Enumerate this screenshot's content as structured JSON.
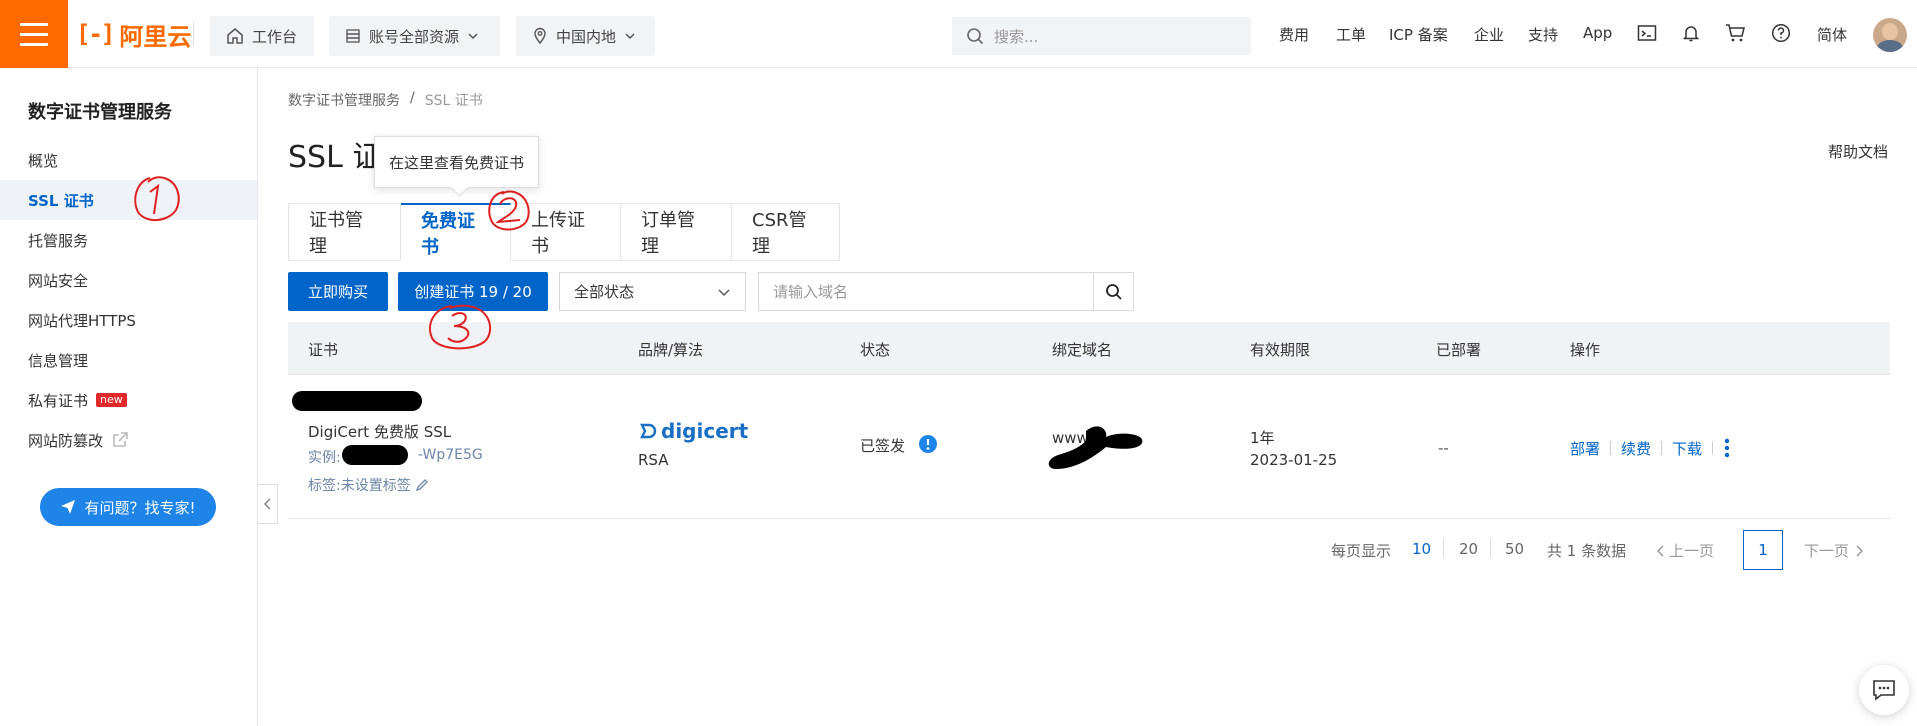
{
  "topbar": {
    "logo": "阿里云",
    "workbench": "工作台",
    "resources": "账号全部资源",
    "region": "中国内地",
    "search_placeholder": "搜索...",
    "links": [
      "费用",
      "工单",
      "ICP 备案",
      "企业",
      "支持",
      "App"
    ],
    "lang": "简体"
  },
  "sidebar": {
    "title": "数字证书管理服务",
    "items": [
      {
        "label": "概览"
      },
      {
        "label": "SSL 证书"
      },
      {
        "label": "托管服务"
      },
      {
        "label": "网站安全"
      },
      {
        "label": "网站代理HTTPS"
      },
      {
        "label": "信息管理"
      },
      {
        "label": "私有证书",
        "badge": "new"
      },
      {
        "label": "网站防篡改"
      }
    ],
    "expert_button": "有问题？找专家!"
  },
  "breadcrumb": {
    "parent": "数字证书管理服务",
    "sep": "/",
    "current": "SSL 证书"
  },
  "page": {
    "title": "SSL 证",
    "help": "帮助文档"
  },
  "tooltip": "在这里查看免费证书",
  "tabs": [
    "证书管理",
    "免费证书",
    "上传证书",
    "订单管理",
    "CSR管理"
  ],
  "toolbar": {
    "buy": "立即购买",
    "create": "创建证书 19 / 20",
    "status_select": "全部状态",
    "domain_placeholder": "请输入域名"
  },
  "table": {
    "headers": [
      "证书",
      "品牌/算法",
      "状态",
      "绑定域名",
      "有效期限",
      "已部署",
      "操作"
    ],
    "row": {
      "cert_name": "DigiCert 免费版 SSL",
      "instance_prefix": "实例:",
      "instance_suffix": "-Wp7E5G",
      "tag": "标签:未设置标签",
      "brand": "digicert",
      "algorithm": "RSA",
      "status": "已签发",
      "domain": "www",
      "validity_years": "1年",
      "validity_date": "2023-01-25",
      "deployed": "--",
      "ops": [
        "部署",
        "续费",
        "下载"
      ]
    }
  },
  "pagination": {
    "per_page_label": "每页显示",
    "sizes": [
      "10",
      "20",
      "50"
    ],
    "total": "共 1 条数据",
    "prev": "上一页",
    "current": "1",
    "next": "下一页"
  },
  "colors": {
    "brand": "#ff6a00",
    "primary": "#0064c8",
    "annotation": "#e02020"
  }
}
